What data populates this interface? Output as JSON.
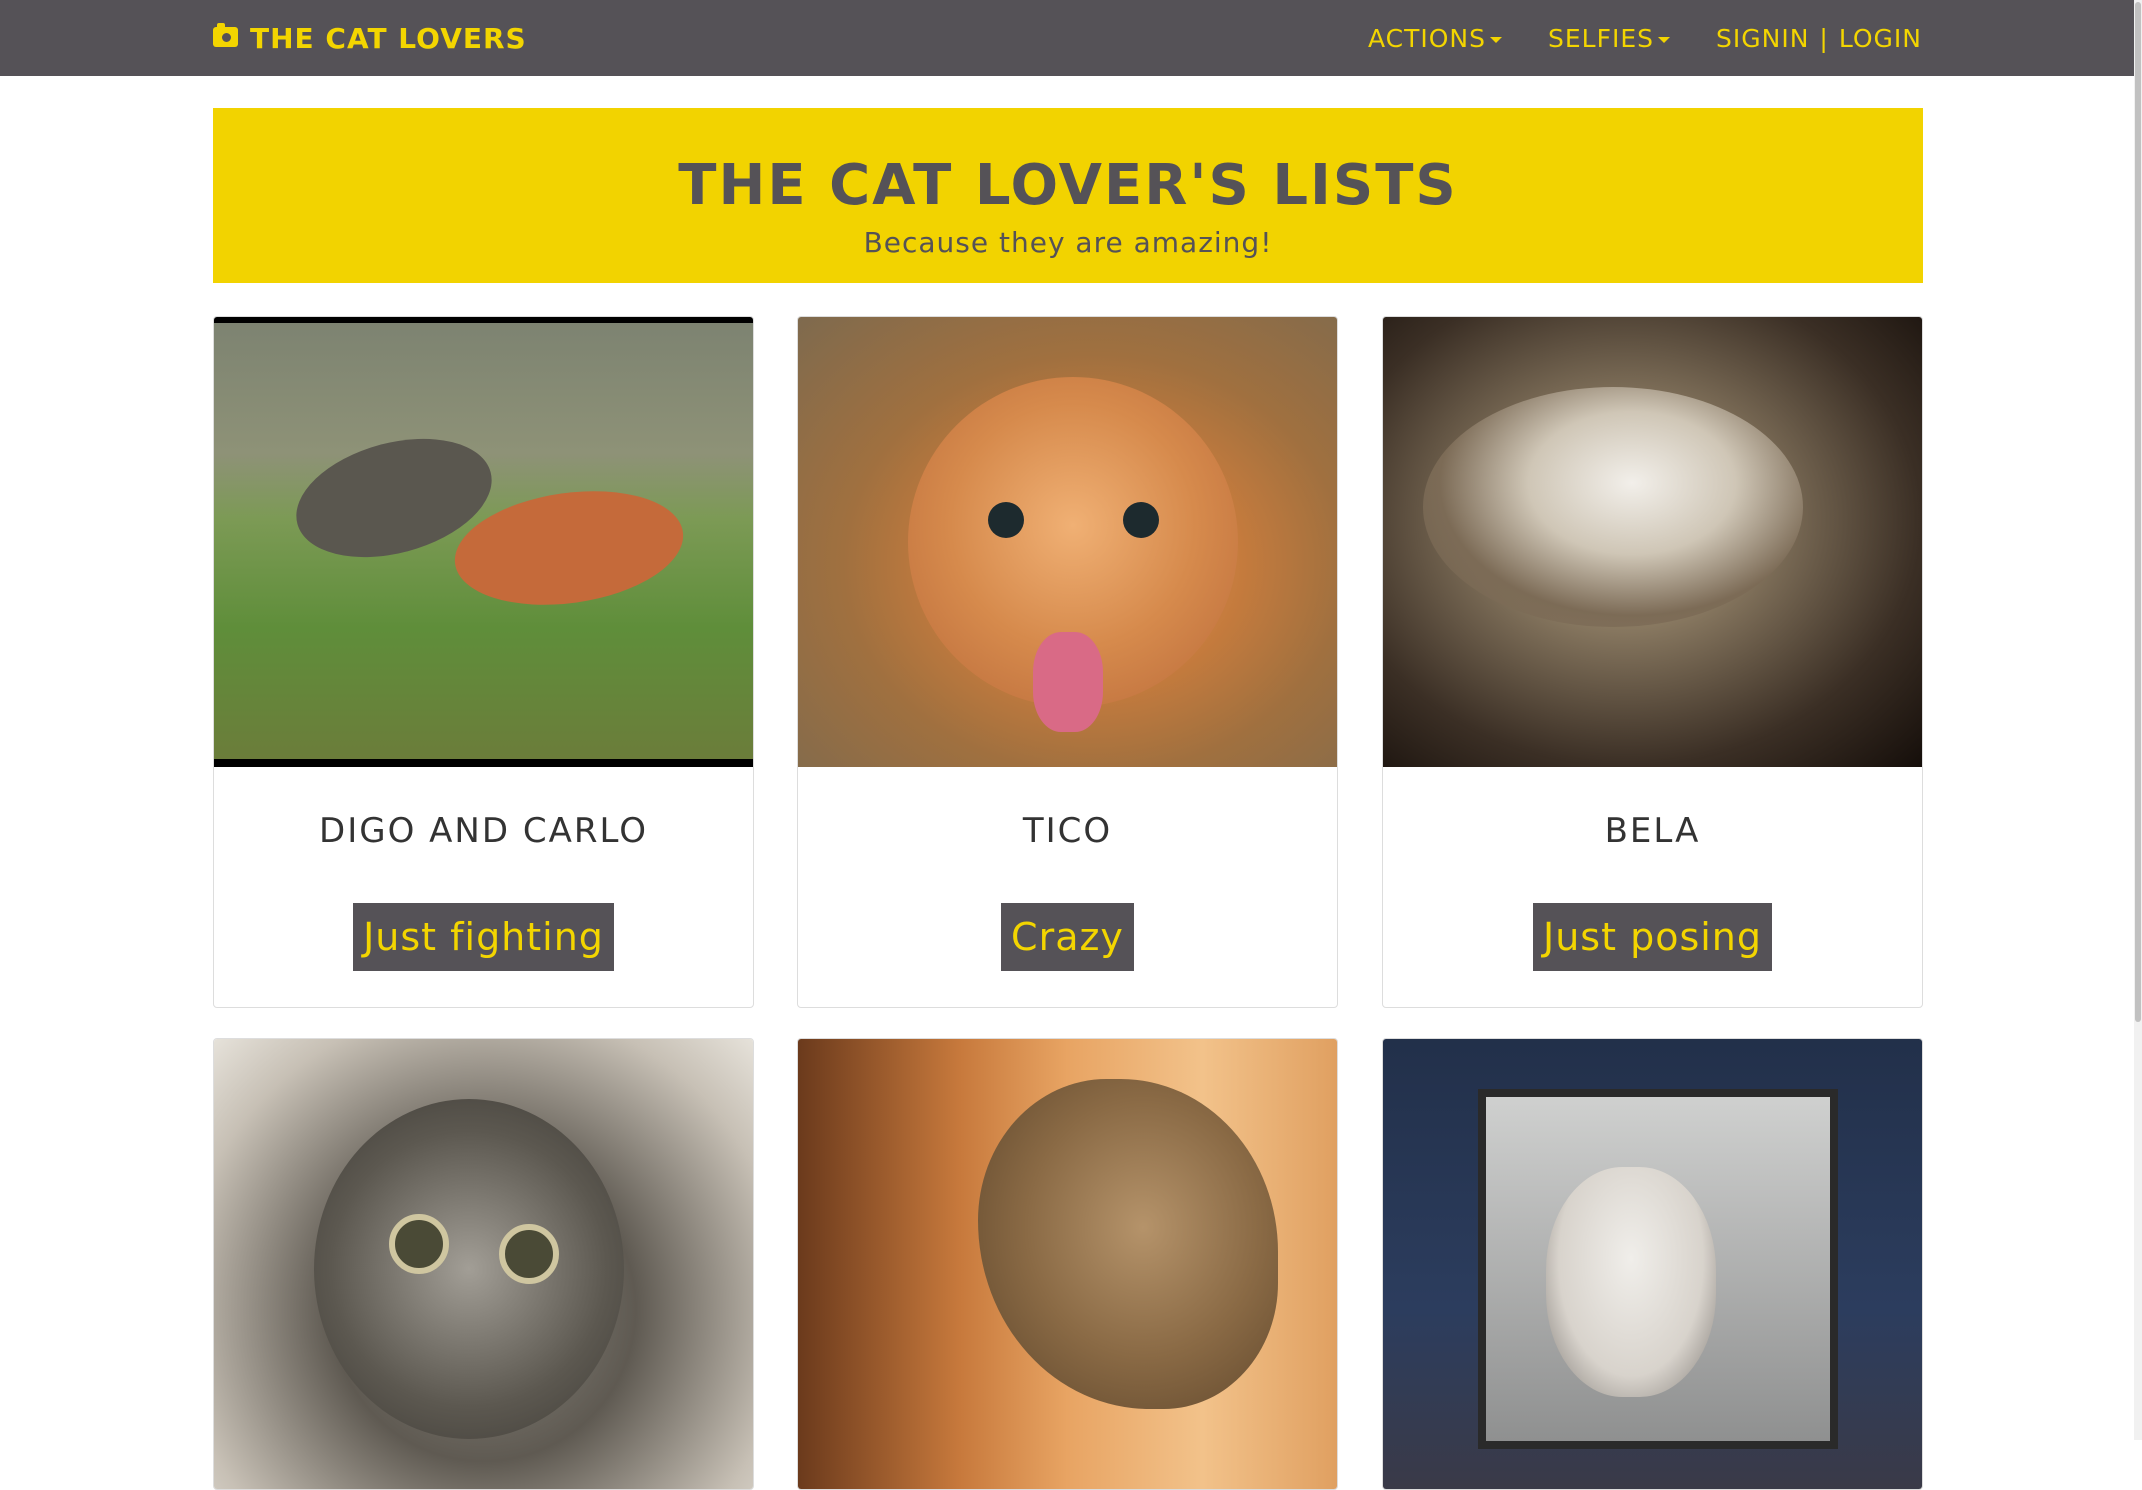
{
  "navbar": {
    "brand": "THE CAT LOVERS",
    "brand_icon": "camera-icon",
    "items": [
      {
        "label": "ACTIONS"
      },
      {
        "label": "SELFIES"
      }
    ],
    "signin": "SIGNIN",
    "separator": "|",
    "login": "LOGIN",
    "accent_color": "#f3d500",
    "bar_color": "#555257"
  },
  "hero": {
    "title": "THE CAT LOVER'S LISTS",
    "subtitle": "Because they are amazing!",
    "background_color": "#f2d300"
  },
  "cards": [
    {
      "name": "DIGO AND CARLO",
      "tag": "Just fighting"
    },
    {
      "name": "TICO",
      "tag": "Crazy"
    },
    {
      "name": "BELA",
      "tag": "Just posing"
    },
    {
      "name": "",
      "tag": ""
    },
    {
      "name": "",
      "tag": ""
    },
    {
      "name": "",
      "tag": ""
    }
  ]
}
